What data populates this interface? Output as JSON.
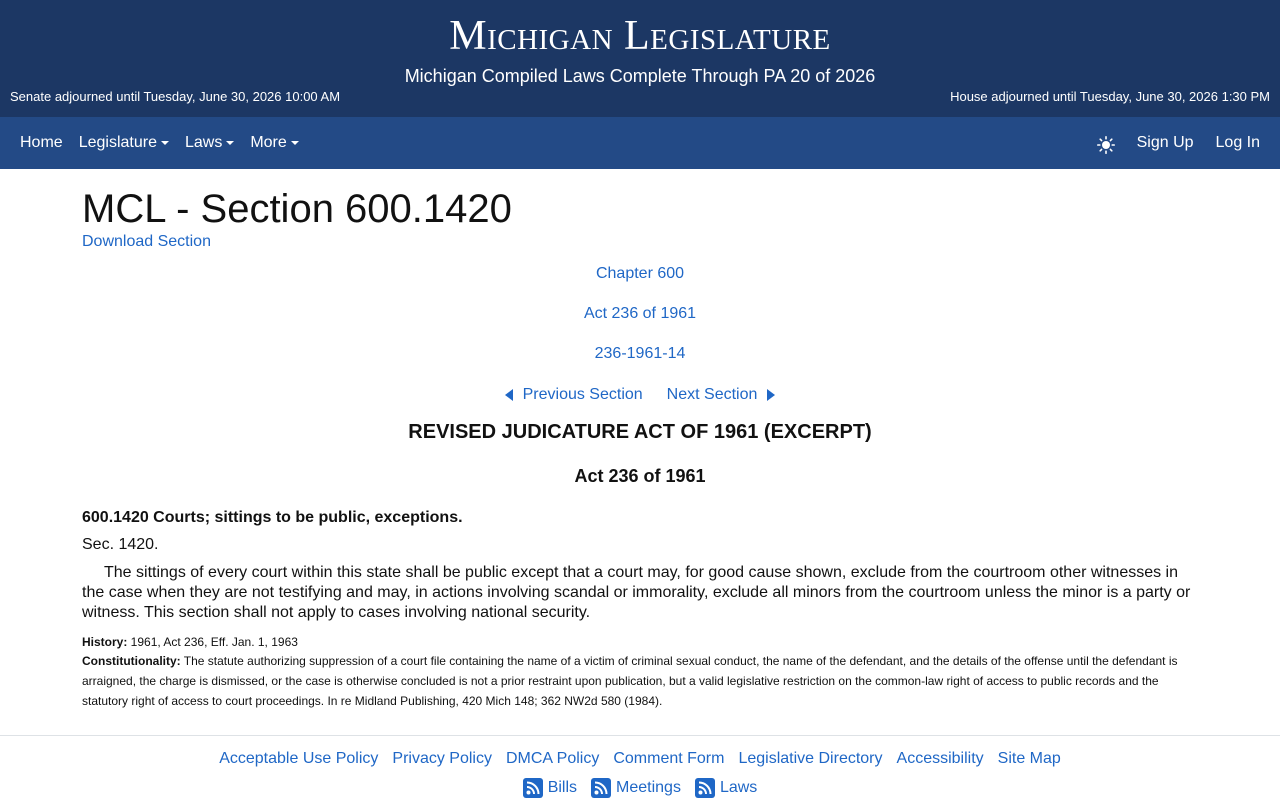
{
  "header": {
    "title": "Michigan Legislature",
    "subtitle": "Michigan Compiled Laws Complete Through PA 20 of 2026",
    "senate_status": "Senate adjourned until Tuesday, June 30, 2026 10:00 AM",
    "house_status": "House adjourned until Tuesday, June 30, 2026 1:30 PM"
  },
  "nav": {
    "items": [
      {
        "label": "Home",
        "dropdown": false
      },
      {
        "label": "Legislature",
        "dropdown": true
      },
      {
        "label": "Laws",
        "dropdown": true
      },
      {
        "label": "More",
        "dropdown": true
      }
    ],
    "theme_icon": "sun-icon",
    "sign_up": "Sign Up",
    "log_in": "Log In"
  },
  "content": {
    "page_title": "MCL - Section 600.1420",
    "download_link": "Download Section",
    "chapter_link": "Chapter 600",
    "act_link": "Act 236 of 1961",
    "part_link": "236-1961-14",
    "previous_section": "Previous Section",
    "next_section": "Next Section",
    "act_title": "REVISED JUDICATURE ACT OF 1961 (EXCERPT)",
    "act_subtitle": "Act 236 of 1961",
    "section_heading": "600.1420 Courts; sittings to be public, exceptions.",
    "sec_label": "Sec. 1420.",
    "section_body": "The sittings of every court within this state shall be public except that a court may, for good cause shown, exclude from the courtroom other witnesses in the case when they are not testifying and may, in actions involving scandal or immorality, exclude all minors from the courtroom unless the minor is a party or witness. This section shall not apply to cases involving national security.",
    "history_label": "History:",
    "history_text": " 1961, Act 236, Eff. Jan. 1, 1963",
    "constitutionality_label": "Constitutionality:",
    "constitutionality_text": " The statute authorizing suppression of a court file containing the name of a victim of criminal sexual conduct, the name of the defendant, and the details of the offense until the defendant is arraigned, the charge is dismissed, or the case is otherwise concluded is not a prior restraint upon publication, but a valid legislative restriction on the common-law right of access to public records and the statutory right of access to court proceedings. In re Midland Publishing, 420 Mich 148; 362 NW2d 580 (1984)."
  },
  "footer": {
    "links": [
      "Acceptable Use Policy",
      "Privacy Policy",
      "DMCA Policy",
      "Comment Form",
      "Legislative Directory",
      "Accessibility",
      "Site Map"
    ],
    "feeds": [
      "Bills",
      "Meetings",
      "Laws"
    ],
    "feed_icon": "rss-icon"
  },
  "colors": {
    "header_bg": "#1c3764",
    "nav_bg": "#234a86",
    "link": "#1f67c6",
    "rss": "#1f67c6"
  }
}
